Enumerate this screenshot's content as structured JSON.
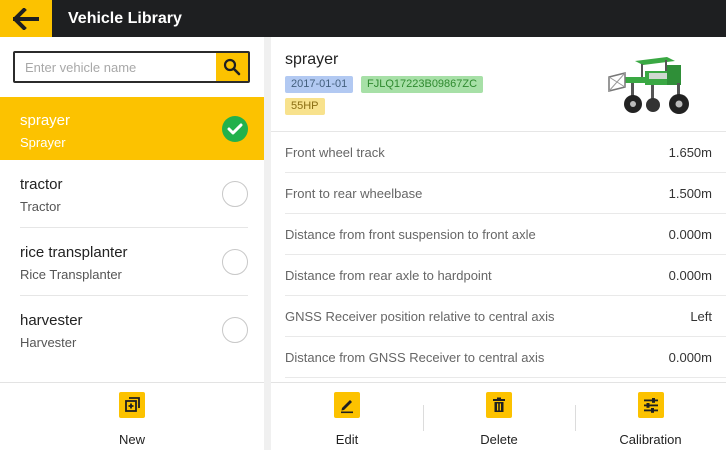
{
  "header": {
    "title": "Vehicle Library",
    "back_icon": "arrow-left-icon"
  },
  "search": {
    "placeholder": "Enter vehicle name",
    "value": ""
  },
  "vehicles": [
    {
      "name": "sprayer",
      "type": "Sprayer",
      "selected": true
    },
    {
      "name": "tractor",
      "type": "Tractor",
      "selected": false
    },
    {
      "name": "rice transplanter",
      "type": "Rice Transplanter",
      "selected": false
    },
    {
      "name": "harvester",
      "type": "Harvester",
      "selected": false
    }
  ],
  "left_footer": {
    "new_label": "New"
  },
  "detail": {
    "title": "sprayer",
    "date": "2017-01-01",
    "serial": "FJLQ17223B09867ZC",
    "power": "55HP",
    "params": [
      {
        "label": "Front wheel track",
        "value": "1.650m"
      },
      {
        "label": "Front to rear wheelbase",
        "value": "1.500m"
      },
      {
        "label": "Distance from front suspension to front axle",
        "value": "0.000m"
      },
      {
        "label": "Distance from rear axle to hardpoint",
        "value": "0.000m"
      },
      {
        "label": "GNSS Receiver position relative to central axis",
        "value": "Left"
      },
      {
        "label": "Distance from GNSS Receiver to central axis",
        "value": "0.000m"
      }
    ]
  },
  "right_footer": {
    "edit_label": "Edit",
    "delete_label": "Delete",
    "calibration_label": "Calibration"
  },
  "colors": {
    "accent": "#fcc200",
    "header_bg": "#1e1f21",
    "check_green": "#22b14c"
  }
}
